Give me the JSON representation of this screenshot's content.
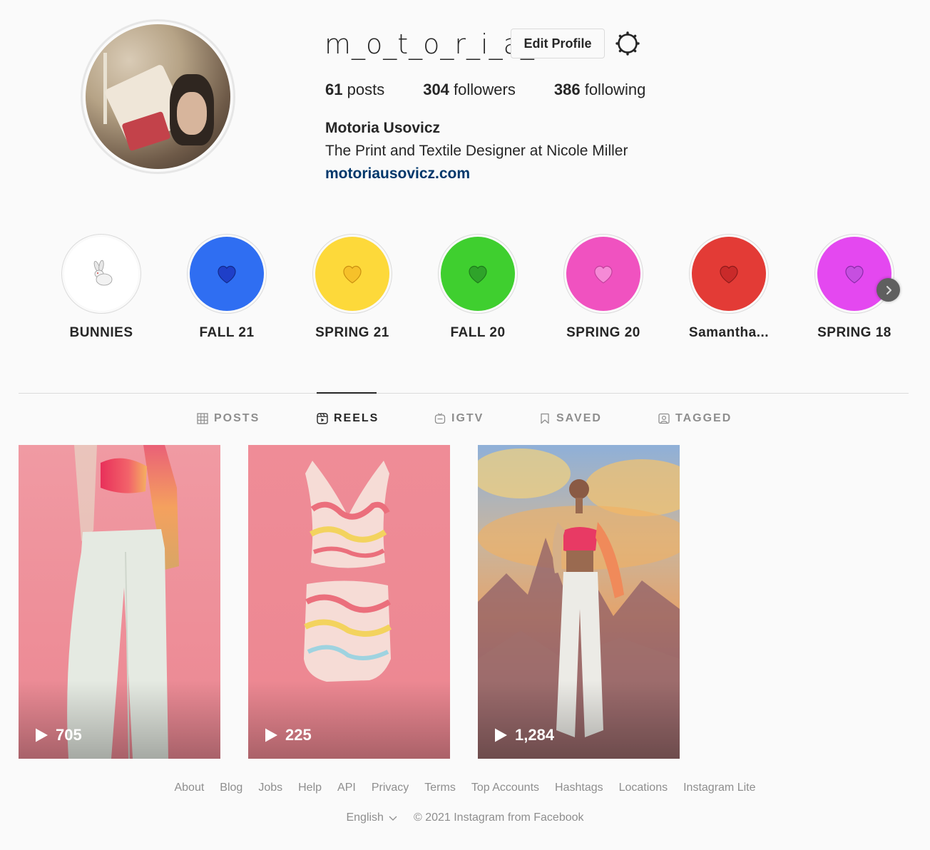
{
  "profile": {
    "username": "m_o_t_o_r_i_a_",
    "edit_label": "Edit Profile",
    "posts_count": "61",
    "posts_label": "posts",
    "followers_count": "304",
    "followers_label": "followers",
    "following_count": "386",
    "following_label": "following",
    "full_name": "Motoria Usovicz",
    "bio": "The Print and Textile Designer at Nicole Miller",
    "website": "motoriausovicz.com"
  },
  "highlights": [
    {
      "label": "BUNNIES",
      "icon": "rabbit-icon",
      "color": "#ffffff"
    },
    {
      "label": "FALL 21",
      "icon": "blue-heart-icon",
      "color": "#2f6ef2"
    },
    {
      "label": "SPRING 21",
      "icon": "yellow-heart-icon",
      "color": "#fdd93a"
    },
    {
      "label": "FALL 20",
      "icon": "green-heart-icon",
      "color": "#3fcf2f"
    },
    {
      "label": "SPRING 20",
      "icon": "pink-heart-icon",
      "color": "#f052c0"
    },
    {
      "label": "Samantha...",
      "icon": "red-heart-icon",
      "color": "#e33b36"
    },
    {
      "label": "SPRING 18",
      "icon": "purple-heart-icon",
      "color": "#e448f0"
    }
  ],
  "tabs": [
    {
      "label": "POSTS",
      "active": false
    },
    {
      "label": "REELS",
      "active": true
    },
    {
      "label": "IGTV",
      "active": false
    },
    {
      "label": "SAVED",
      "active": false
    },
    {
      "label": "TAGGED",
      "active": false
    }
  ],
  "reels": [
    {
      "views": "705"
    },
    {
      "views": "225"
    },
    {
      "views": "1,284"
    }
  ],
  "footer": {
    "links": [
      "About",
      "Blog",
      "Jobs",
      "Help",
      "API",
      "Privacy",
      "Terms",
      "Top Accounts",
      "Hashtags",
      "Locations",
      "Instagram Lite"
    ],
    "language": "English",
    "copyright": "© 2021 Instagram from Facebook"
  }
}
